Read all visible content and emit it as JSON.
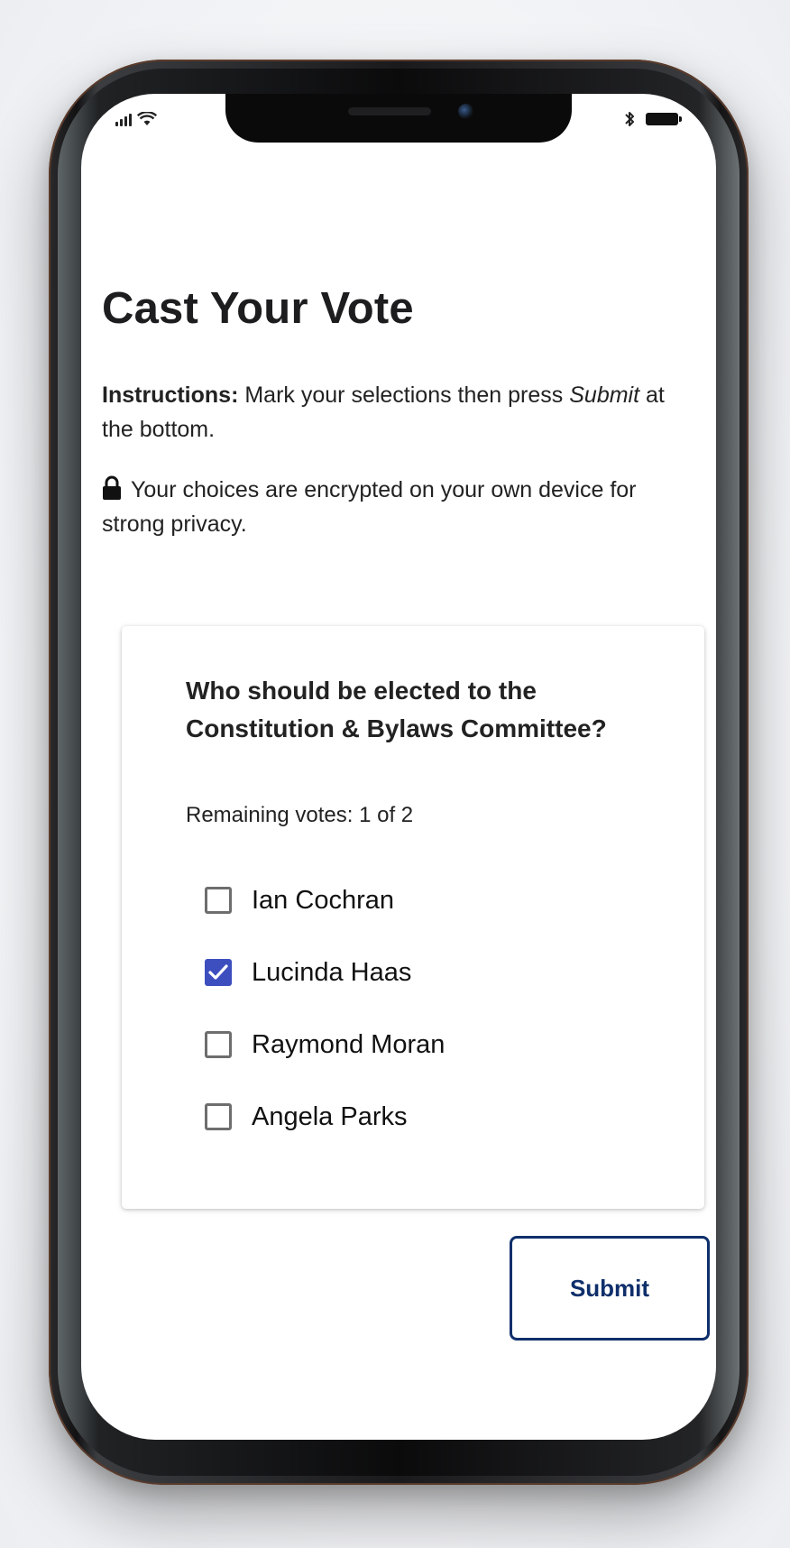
{
  "page": {
    "title": "Cast Your Vote",
    "instructions_label": "Instructions:",
    "instructions_text_1": "Mark your selections then press",
    "instructions_submit_word": "Submit",
    "instructions_text_2": "at the bottom.",
    "privacy_text": "Your choices are encrypted on your own device for strong privacy."
  },
  "contest": {
    "question": "Who should be elected to the Constitution & Bylaws Committee?",
    "remaining_votes": "Remaining votes: 1 of 2",
    "options": [
      {
        "label": "Ian Cochran",
        "checked": false
      },
      {
        "label": "Lucinda Haas",
        "checked": true
      },
      {
        "label": "Raymond Moran",
        "checked": false
      },
      {
        "label": "Angela Parks",
        "checked": false
      }
    ]
  },
  "actions": {
    "submit_label": "Submit"
  },
  "icons": {
    "lock": "lock-icon",
    "checkmark": "checkmark-icon",
    "signal": "cellular-signal-icon",
    "wifi": "wifi-icon",
    "bluetooth": "bluetooth-icon",
    "battery": "battery-icon"
  },
  "colors": {
    "checkbox_checked": "#3d4fbf",
    "submit_border": "#0f2f6b",
    "text": "#222222"
  }
}
